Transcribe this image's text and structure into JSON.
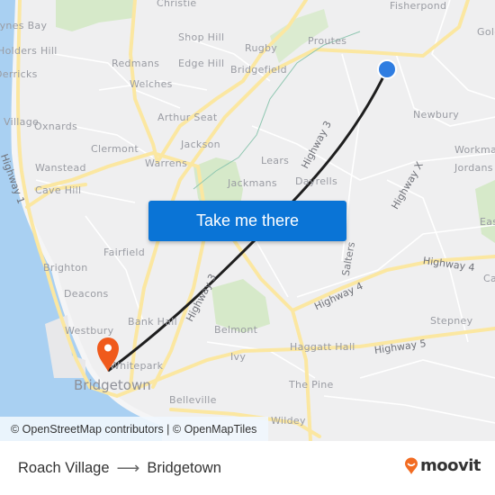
{
  "map": {
    "places": [
      {
        "name": "Christie"
      },
      {
        "name": "Fisherpond"
      },
      {
        "name": "Gold"
      },
      {
        "name": "Proutes"
      },
      {
        "name": "Shop Hill"
      },
      {
        "name": "Rugby"
      },
      {
        "name": "Redmans"
      },
      {
        "name": "Edge Hill"
      },
      {
        "name": "Bridgefield"
      },
      {
        "name": "Welches"
      },
      {
        "name": "Newbury"
      },
      {
        "name": "Arthur Seat"
      },
      {
        "name": "Jackson"
      },
      {
        "name": "Clermont"
      },
      {
        "name": "Warrens"
      },
      {
        "name": "Lears"
      },
      {
        "name": "Workman"
      },
      {
        "name": "Jordans"
      },
      {
        "name": "Wanstead"
      },
      {
        "name": "Cave Hill"
      },
      {
        "name": "Jackmans"
      },
      {
        "name": "Dayrells"
      },
      {
        "name": "East"
      },
      {
        "name": "Fairfield"
      },
      {
        "name": "Salters"
      },
      {
        "name": "Brighton"
      },
      {
        "name": "Cane"
      },
      {
        "name": "Deacons"
      },
      {
        "name": "Bank Hall"
      },
      {
        "name": "Stepney"
      },
      {
        "name": "Westbury"
      },
      {
        "name": "Belmont"
      },
      {
        "name": "Haggatt Hall"
      },
      {
        "name": "Whitepark"
      },
      {
        "name": "Ivy"
      },
      {
        "name": "Bridgetown"
      },
      {
        "name": "The Pine"
      },
      {
        "name": "Belleville"
      },
      {
        "name": "Wildey"
      },
      {
        "name": "Haynes Bay"
      },
      {
        "name": "Holders Hill"
      },
      {
        "name": "Derricks"
      },
      {
        "name": "Oxnards"
      },
      {
        "name": "Village"
      }
    ],
    "highways": [
      {
        "name": "Highway 1"
      },
      {
        "name": "Highway 3"
      },
      {
        "name": "Highway 3"
      },
      {
        "name": "Highway X"
      },
      {
        "name": "Highway 4"
      },
      {
        "name": "Highway 4"
      },
      {
        "name": "Highway 5"
      }
    ],
    "origin_marker": {
      "label": "Roach Village",
      "icon": "location-dot-icon",
      "color": "#2f7de1"
    },
    "destination_marker": {
      "label": "Bridgetown",
      "icon": "map-pin-icon",
      "color": "#f05a1c"
    },
    "route_color": "#1e1e1e",
    "colors": {
      "water": "#a9d0f2",
      "land": "#efeff0",
      "park": "#d6e9c9",
      "road_major": "#fbe7a1",
      "road_minor": "#ffffff"
    }
  },
  "cta": {
    "label": "Take me there",
    "color": "#0a74d6"
  },
  "attribution": "© OpenStreetMap contributors | © OpenMapTiles",
  "footer": {
    "origin": "Roach Village",
    "arrow": "⟶",
    "destination": "Bridgetown",
    "logo_text": "moovit",
    "logo_color": "#f26b21"
  }
}
